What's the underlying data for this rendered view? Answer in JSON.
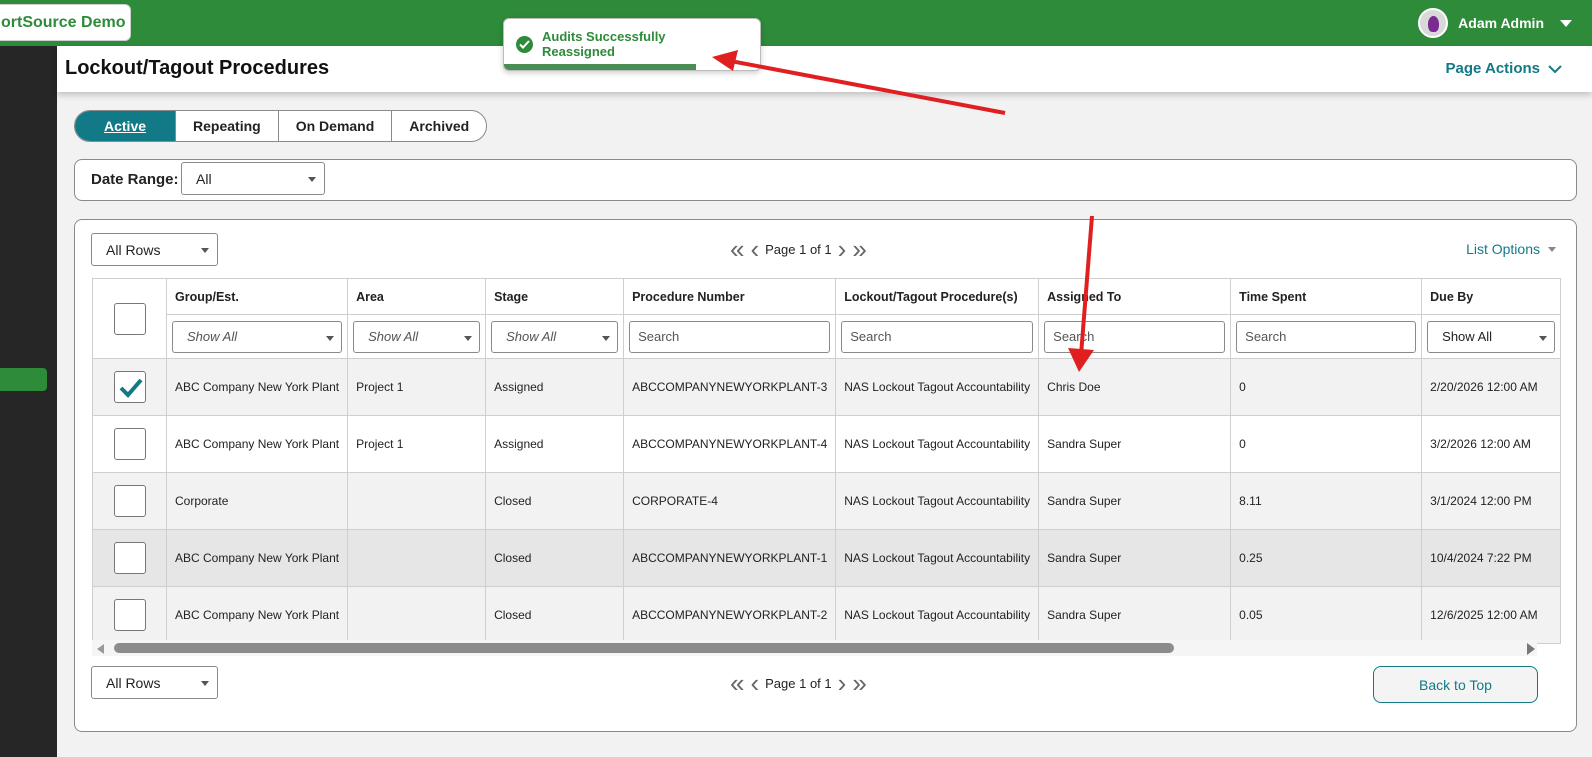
{
  "app": {
    "brand": "ortSource Demo",
    "user_name": "Adam Admin"
  },
  "colors": {
    "brand_green": "#2e8b3a",
    "teal": "#127a87",
    "sidebar": "#262626",
    "annotation_red": "#e02020"
  },
  "header": {
    "title": "Lockout/Tagout Procedures",
    "page_actions": "Page Actions"
  },
  "toast": {
    "message": "Audits Successfully Reassigned",
    "progress": 0.75
  },
  "tabs": [
    {
      "label": "Active",
      "active": true
    },
    {
      "label": "Repeating",
      "active": false
    },
    {
      "label": "On Demand",
      "active": false
    },
    {
      "label": "Archived",
      "active": false
    }
  ],
  "date_range": {
    "label": "Date Range:",
    "value": "All"
  },
  "list": {
    "rows_select": "All Rows",
    "page_info": "Page 1 of 1",
    "list_options": "List Options",
    "back_to_top": "Back to Top",
    "columns": [
      "Group/Est.",
      "Area",
      "Stage",
      "Procedure Number",
      "Lockout/Tagout Procedure(s)",
      "Assigned To",
      "Time Spent",
      "Due By"
    ],
    "filters": [
      "Show All",
      "Show All",
      "Show All",
      "Search",
      "Search",
      "Search",
      "Search",
      "Show All"
    ],
    "rows": [
      {
        "checked": true,
        "cells": [
          "ABC Company New York Plant",
          "Project 1",
          "Assigned",
          "ABCCOMPANYNEWYORKPLANT-3",
          "NAS Lockout Tagout Accountability",
          "Chris Doe",
          "0",
          "2/20/2026 12:00 AM"
        ]
      },
      {
        "checked": false,
        "cells": [
          "ABC Company New York Plant",
          "Project 1",
          "Assigned",
          "ABCCOMPANYNEWYORKPLANT-4",
          "NAS Lockout Tagout Accountability",
          "Sandra Super",
          "0",
          "3/2/2026 12:00 AM"
        ]
      },
      {
        "checked": false,
        "cells": [
          "Corporate",
          "",
          "Closed",
          "CORPORATE-4",
          "NAS Lockout Tagout Accountability",
          "Sandra Super",
          "8.11",
          "3/1/2024 12:00 PM"
        ]
      },
      {
        "checked": false,
        "cells": [
          "ABC Company New York Plant",
          "",
          "Closed",
          "ABCCOMPANYNEWYORKPLANT-1",
          "NAS Lockout Tagout Accountability",
          "Sandra Super",
          "0.25",
          "10/4/2024 7:22 PM"
        ]
      },
      {
        "checked": false,
        "cells": [
          "ABC Company New York Plant",
          "",
          "Closed",
          "ABCCOMPANYNEWYORKPLANT-2",
          "NAS Lockout Tagout Accountability",
          "Sandra Super",
          "0.05",
          "12/6/2025 12:00 AM"
        ]
      }
    ]
  }
}
